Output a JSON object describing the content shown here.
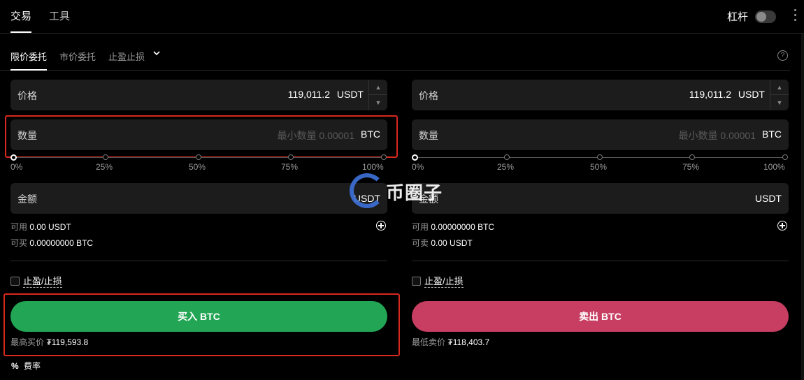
{
  "topnav": {
    "tabs": [
      {
        "label": "交易"
      },
      {
        "label": "工具"
      }
    ],
    "leverage_label": "杠杆"
  },
  "order_types": {
    "tabs": [
      {
        "label": "限价委托"
      },
      {
        "label": "市价委托"
      },
      {
        "label": "止盈止损"
      }
    ]
  },
  "buy": {
    "price": {
      "label": "价格",
      "value": "119,011.2",
      "unit": "USDT"
    },
    "quantity": {
      "label": "数量",
      "placeholder": "最小数量 0.00001",
      "unit": "BTC",
      "slider_value": 0
    },
    "amount": {
      "label": "金额",
      "unit": "USDT"
    },
    "slider_marks": [
      "0%",
      "25%",
      "50%",
      "75%",
      "100%"
    ],
    "available_label": "可用",
    "available_value": "0.00 USDT",
    "can_buy_label": "可买",
    "can_buy_value": "0.00000000 BTC",
    "tpsl_label": "止盈/止损",
    "button_label": "买入 BTC",
    "best_price_label": "最高买价",
    "best_price_value": "₮119,593.8"
  },
  "sell": {
    "price": {
      "label": "价格",
      "value": "119,011.2",
      "unit": "USDT"
    },
    "quantity": {
      "label": "数量",
      "placeholder": "最小数量 0.00001",
      "unit": "BTC",
      "slider_value": 0
    },
    "amount": {
      "label": "金额",
      "unit": "USDT"
    },
    "slider_marks": [
      "0%",
      "25%",
      "50%",
      "75%",
      "100%"
    ],
    "available_label": "可用",
    "available_value": "0.00000000 BTC",
    "can_sell_label": "可卖",
    "can_sell_value": "0.00 USDT",
    "tpsl_label": "止盈/止损",
    "button_label": "卖出 BTC",
    "best_price_label": "最低卖价",
    "best_price_value": "₮118,403.7"
  },
  "fee": {
    "icon": "%",
    "label": "费率"
  },
  "watermark": {
    "text": "币圈子"
  },
  "colors": {
    "buy": "#22a554",
    "sell": "#c73e62",
    "highlight": "#d9281e",
    "logo": "#3d6fd6"
  }
}
